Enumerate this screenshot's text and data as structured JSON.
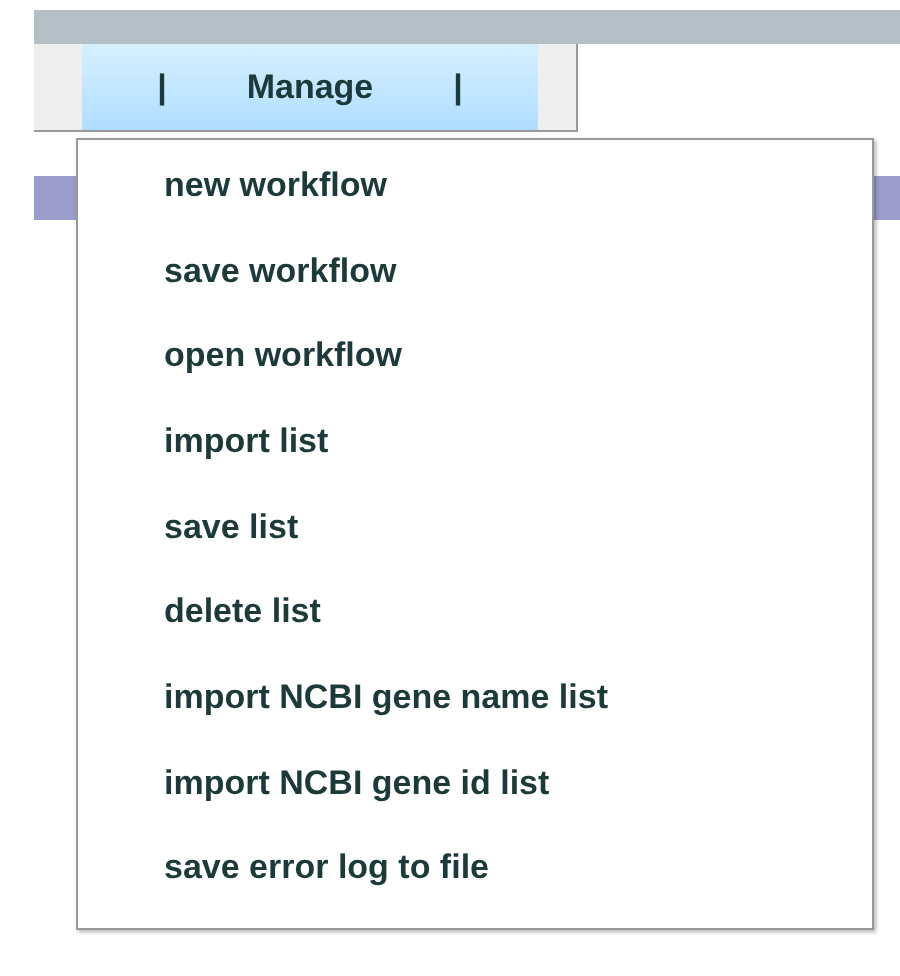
{
  "menu_bar": {
    "menus": [
      {
        "label": "Manage",
        "separator_left": "|",
        "separator_right": "|",
        "selected": true
      }
    ]
  },
  "dropdown": {
    "items": [
      {
        "label": "new workflow"
      },
      {
        "label": "save workflow"
      },
      {
        "label": "open workflow"
      },
      {
        "label": "import list"
      },
      {
        "label": "save list"
      },
      {
        "label": "delete list"
      },
      {
        "label": "import NCBI gene name list"
      },
      {
        "label": "import NCBI gene id list"
      },
      {
        "label": "save error log to file"
      }
    ]
  }
}
